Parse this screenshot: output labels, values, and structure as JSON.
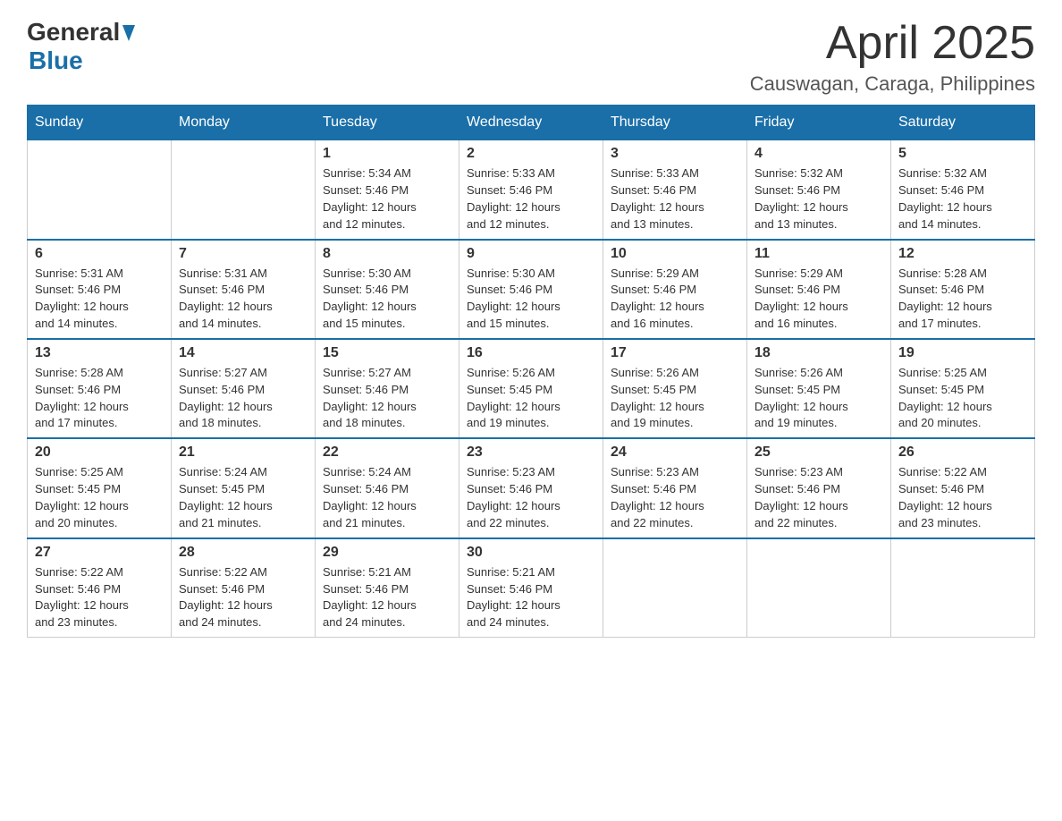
{
  "header": {
    "logo_general": "General",
    "logo_blue": "Blue",
    "month_title": "April 2025",
    "location": "Causwagan, Caraga, Philippines"
  },
  "weekdays": [
    "Sunday",
    "Monday",
    "Tuesday",
    "Wednesday",
    "Thursday",
    "Friday",
    "Saturday"
  ],
  "weeks": [
    [
      {
        "day": "",
        "info": ""
      },
      {
        "day": "",
        "info": ""
      },
      {
        "day": "1",
        "info": "Sunrise: 5:34 AM\nSunset: 5:46 PM\nDaylight: 12 hours\nand 12 minutes."
      },
      {
        "day": "2",
        "info": "Sunrise: 5:33 AM\nSunset: 5:46 PM\nDaylight: 12 hours\nand 12 minutes."
      },
      {
        "day": "3",
        "info": "Sunrise: 5:33 AM\nSunset: 5:46 PM\nDaylight: 12 hours\nand 13 minutes."
      },
      {
        "day": "4",
        "info": "Sunrise: 5:32 AM\nSunset: 5:46 PM\nDaylight: 12 hours\nand 13 minutes."
      },
      {
        "day": "5",
        "info": "Sunrise: 5:32 AM\nSunset: 5:46 PM\nDaylight: 12 hours\nand 14 minutes."
      }
    ],
    [
      {
        "day": "6",
        "info": "Sunrise: 5:31 AM\nSunset: 5:46 PM\nDaylight: 12 hours\nand 14 minutes."
      },
      {
        "day": "7",
        "info": "Sunrise: 5:31 AM\nSunset: 5:46 PM\nDaylight: 12 hours\nand 14 minutes."
      },
      {
        "day": "8",
        "info": "Sunrise: 5:30 AM\nSunset: 5:46 PM\nDaylight: 12 hours\nand 15 minutes."
      },
      {
        "day": "9",
        "info": "Sunrise: 5:30 AM\nSunset: 5:46 PM\nDaylight: 12 hours\nand 15 minutes."
      },
      {
        "day": "10",
        "info": "Sunrise: 5:29 AM\nSunset: 5:46 PM\nDaylight: 12 hours\nand 16 minutes."
      },
      {
        "day": "11",
        "info": "Sunrise: 5:29 AM\nSunset: 5:46 PM\nDaylight: 12 hours\nand 16 minutes."
      },
      {
        "day": "12",
        "info": "Sunrise: 5:28 AM\nSunset: 5:46 PM\nDaylight: 12 hours\nand 17 minutes."
      }
    ],
    [
      {
        "day": "13",
        "info": "Sunrise: 5:28 AM\nSunset: 5:46 PM\nDaylight: 12 hours\nand 17 minutes."
      },
      {
        "day": "14",
        "info": "Sunrise: 5:27 AM\nSunset: 5:46 PM\nDaylight: 12 hours\nand 18 minutes."
      },
      {
        "day": "15",
        "info": "Sunrise: 5:27 AM\nSunset: 5:46 PM\nDaylight: 12 hours\nand 18 minutes."
      },
      {
        "day": "16",
        "info": "Sunrise: 5:26 AM\nSunset: 5:45 PM\nDaylight: 12 hours\nand 19 minutes."
      },
      {
        "day": "17",
        "info": "Sunrise: 5:26 AM\nSunset: 5:45 PM\nDaylight: 12 hours\nand 19 minutes."
      },
      {
        "day": "18",
        "info": "Sunrise: 5:26 AM\nSunset: 5:45 PM\nDaylight: 12 hours\nand 19 minutes."
      },
      {
        "day": "19",
        "info": "Sunrise: 5:25 AM\nSunset: 5:45 PM\nDaylight: 12 hours\nand 20 minutes."
      }
    ],
    [
      {
        "day": "20",
        "info": "Sunrise: 5:25 AM\nSunset: 5:45 PM\nDaylight: 12 hours\nand 20 minutes."
      },
      {
        "day": "21",
        "info": "Sunrise: 5:24 AM\nSunset: 5:45 PM\nDaylight: 12 hours\nand 21 minutes."
      },
      {
        "day": "22",
        "info": "Sunrise: 5:24 AM\nSunset: 5:46 PM\nDaylight: 12 hours\nand 21 minutes."
      },
      {
        "day": "23",
        "info": "Sunrise: 5:23 AM\nSunset: 5:46 PM\nDaylight: 12 hours\nand 22 minutes."
      },
      {
        "day": "24",
        "info": "Sunrise: 5:23 AM\nSunset: 5:46 PM\nDaylight: 12 hours\nand 22 minutes."
      },
      {
        "day": "25",
        "info": "Sunrise: 5:23 AM\nSunset: 5:46 PM\nDaylight: 12 hours\nand 22 minutes."
      },
      {
        "day": "26",
        "info": "Sunrise: 5:22 AM\nSunset: 5:46 PM\nDaylight: 12 hours\nand 23 minutes."
      }
    ],
    [
      {
        "day": "27",
        "info": "Sunrise: 5:22 AM\nSunset: 5:46 PM\nDaylight: 12 hours\nand 23 minutes."
      },
      {
        "day": "28",
        "info": "Sunrise: 5:22 AM\nSunset: 5:46 PM\nDaylight: 12 hours\nand 24 minutes."
      },
      {
        "day": "29",
        "info": "Sunrise: 5:21 AM\nSunset: 5:46 PM\nDaylight: 12 hours\nand 24 minutes."
      },
      {
        "day": "30",
        "info": "Sunrise: 5:21 AM\nSunset: 5:46 PM\nDaylight: 12 hours\nand 24 minutes."
      },
      {
        "day": "",
        "info": ""
      },
      {
        "day": "",
        "info": ""
      },
      {
        "day": "",
        "info": ""
      }
    ]
  ]
}
